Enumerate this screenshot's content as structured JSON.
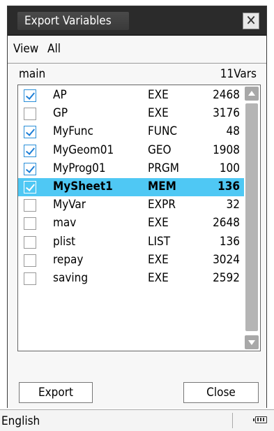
{
  "dialog": {
    "title": "Export Variables",
    "close_glyph": "✕"
  },
  "menu": {
    "view": "View",
    "all": "All"
  },
  "list_header": {
    "folder": "main",
    "count": "11Vars"
  },
  "variables": [
    {
      "name": "AP",
      "type": "EXE",
      "size": "2468",
      "checked": true,
      "selected": false
    },
    {
      "name": "GP",
      "type": "EXE",
      "size": "3176",
      "checked": false,
      "selected": false
    },
    {
      "name": "MyFunc",
      "type": "FUNC",
      "size": "48",
      "checked": true,
      "selected": false
    },
    {
      "name": "MyGeom01",
      "type": "GEO",
      "size": "1908",
      "checked": true,
      "selected": false
    },
    {
      "name": "MyProg01",
      "type": "PRGM",
      "size": "100",
      "checked": true,
      "selected": false
    },
    {
      "name": "MySheet1",
      "type": "MEM",
      "size": "136",
      "checked": true,
      "selected": true
    },
    {
      "name": "MyVar",
      "type": "EXPR",
      "size": "32",
      "checked": false,
      "selected": false
    },
    {
      "name": "mav",
      "type": "EXE",
      "size": "2648",
      "checked": false,
      "selected": false
    },
    {
      "name": "plist",
      "type": "LIST",
      "size": "136",
      "checked": false,
      "selected": false
    },
    {
      "name": "repay",
      "type": "EXE",
      "size": "3024",
      "checked": false,
      "selected": false
    },
    {
      "name": "saving",
      "type": "EXE",
      "size": "2592",
      "checked": false,
      "selected": false
    }
  ],
  "buttons": {
    "export": "Export",
    "close": "Close"
  },
  "status": {
    "language": "English",
    "battery_icon": "battery-icon"
  },
  "colors": {
    "selection": "#4fc8f4",
    "check": "#1e7fd6",
    "titlebar": "#2b2b2b"
  }
}
